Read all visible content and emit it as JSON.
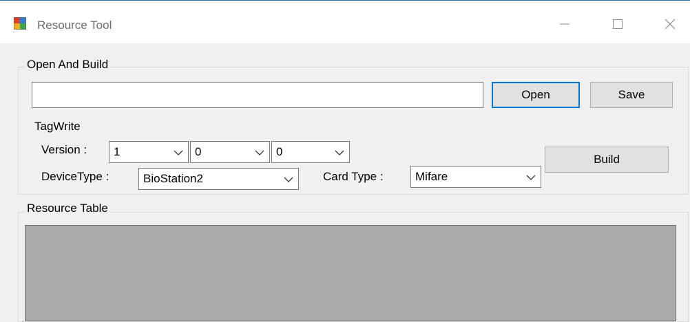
{
  "window": {
    "title": "Resource Tool"
  },
  "open_and_build": {
    "legend": "Open And Build",
    "path_value": "",
    "open_label": "Open",
    "save_label": "Save",
    "tagwrite_label": "TagWrite",
    "version_label": "Version :",
    "version_values": [
      "1",
      "0",
      "0"
    ],
    "device_type_label": "DeviceType :",
    "device_type_value": "BioStation2",
    "card_type_label": "Card Type :",
    "card_type_value": "Mifare",
    "build_label": "Build"
  },
  "resource_table": {
    "legend": "Resource Table"
  },
  "colors": {
    "accent": "#0078d7",
    "window_bg": "#f0f0f0",
    "table_bg": "#ababab"
  },
  "icons": [
    "app-icon",
    "minimize-icon",
    "maximize-icon",
    "close-icon",
    "chevron-down-icon"
  ]
}
